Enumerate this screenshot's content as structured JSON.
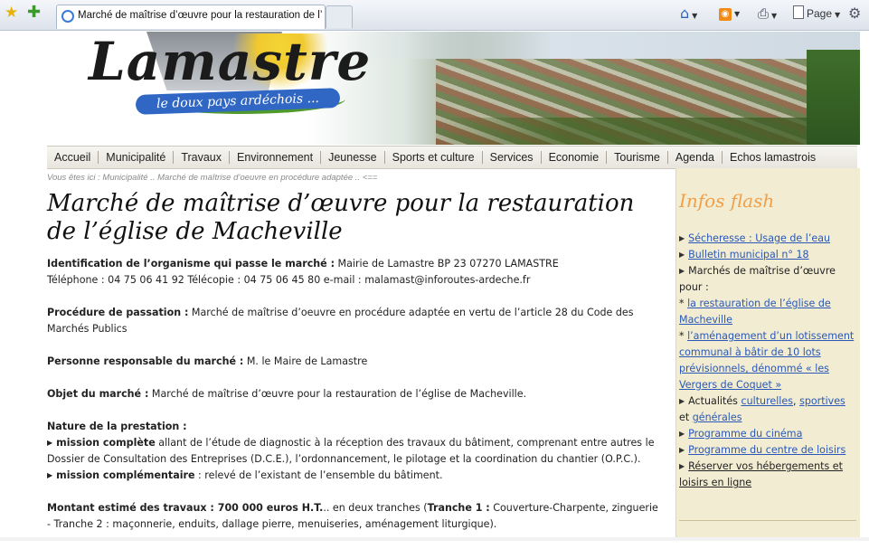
{
  "browser": {
    "tab_title": "Marché de maîtrise d’œuvre pour la restauration de l’é...",
    "page_label": "Page"
  },
  "header": {
    "logo_title": "Lamastre",
    "logo_tagline": "le doux pays ardéchois ..."
  },
  "nav": {
    "items": [
      "Accueil",
      "Municipalité",
      "Travaux",
      "Environnement",
      "Jeunesse",
      "Sports et culture",
      "Services",
      "Economie",
      "Tourisme",
      "Agenda",
      "Echos lamastrois"
    ]
  },
  "breadcrumb": "Vous êtes ici : Municipalité .. Marché de maîtrise d’oeuvre en procédure adaptée .. <==",
  "main": {
    "title": "Marché de maîtrise d’œuvre pour la restauration de l’église de Macheville",
    "ident_label": "Identification de l’organisme qui passe le marché :",
    "ident_value": " Mairie de Lamastre BP 23 07270 LAMASTRE",
    "ident_contact": "Téléphone : 04 75 06 41 92 Télécopie : 04 75 06 45 80 e-mail : malamast@inforoutes-ardeche.fr",
    "procedure_label": "Procédure de passation :",
    "procedure_value": " Marché de maîtrise d’oeuvre en procédure adaptée en vertu de l’article 28 du Code des Marchés Publics",
    "person_label": "Personne responsable du marché :",
    "person_value": " M. le Maire de Lamastre",
    "object_label": "Objet du marché :",
    "object_value": " Marché de maîtrise d’œuvre pour la restauration de l’église de Macheville.",
    "nature_label": "Nature de la prestation :",
    "mission1_label": "mission complète",
    "mission1_value": " allant de l’étude de diagnostic à la réception des travaux du bâtiment, comprenant entre autres le Dossier de Consultation des Entreprises (D.C.E.), l’ordonnancement, le pilotage et la coordination du chantier (O.P.C.).",
    "mission2_label": "mission complémentaire",
    "mission2_value": " : relevé de l’existant de l’ensemble du bâtiment.",
    "montant_label": "Montant estimé des travaux :",
    "montant_value": " 700 000 euros H.T.",
    "montant_rest": ".. en deux tranches (",
    "tranche1_label": "Tranche 1 :",
    "tranche1_value": " Couverture-Charpente, zinguerie - Tranche 2 : maçonnerie, enduits, dallage pierre, menuiseries, aménagement liturgique)."
  },
  "sidebar": {
    "title": "Infos flash",
    "item1": "Sécheresse : Usage de l’eau",
    "item2": "Bulletin municipal n° 18",
    "item3": "Marchés de maîtrise d’œuvre pour :",
    "item3a": "la restauration de l’église de Macheville",
    "item3b": "l’aménagement d’un lotissement communal à bâtir de 10 lots prévisionnels, dénommé « les Vergers de Coquet »",
    "item4_prefix": "Actualités ",
    "item4_link1": "culturelles",
    "item4_sep": ", ",
    "item4_link2": "sportives",
    "item4_and": "et ",
    "item4_link3": "générales",
    "item5": "Programme du cinéma",
    "item6": "Programme du centre de loisirs",
    "item7": "Réserver vos hébergements et loisirs en ligne"
  }
}
